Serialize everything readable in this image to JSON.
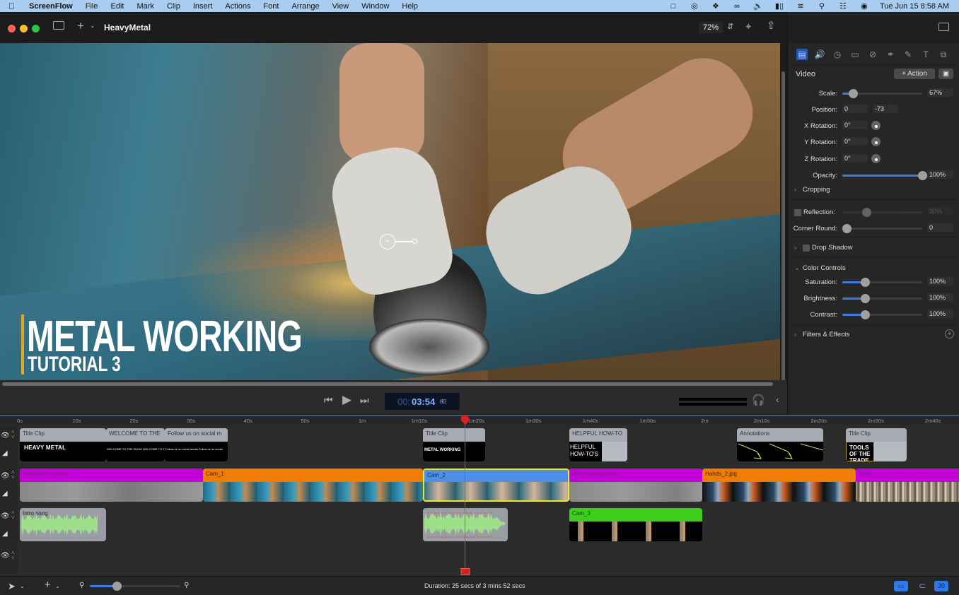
{
  "menubar": {
    "apple": "",
    "app_name": "ScreenFlow",
    "items": [
      "File",
      "Edit",
      "Mark",
      "Clip",
      "Insert",
      "Actions",
      "Font",
      "Arrange",
      "View",
      "Window",
      "Help"
    ],
    "status_icons": [
      "camera-icon",
      "creative-cloud-icon",
      "dropbox-icon",
      "adobe-icon",
      "volume-icon",
      "battery-icon",
      "wifi-icon",
      "search-icon",
      "control-center-icon",
      "siri-icon"
    ],
    "datetime": "Tue Jun 15  8:58 AM"
  },
  "window": {
    "title": "HeavyMetal",
    "add_label": "+",
    "zoom": "72%"
  },
  "preview": {
    "overlay_title": "METAL WORKING",
    "overlay_subtitle": "TUTORIAL 3",
    "overlay_accent": "#e4a51f"
  },
  "transport": {
    "timecode_hours": "00:",
    "timecode_main": "03:54",
    "timecode_frames": "80"
  },
  "inspector": {
    "tabs": [
      "video-icon",
      "audio-icon",
      "video-motion-icon",
      "screen-recording-icon",
      "callout-icon",
      "transition-icon",
      "annotation-icon",
      "text-icon",
      "media-library-icon"
    ],
    "section_title": "Video",
    "action_button": "+ Action",
    "scale_label": "Scale:",
    "scale_value": "67%",
    "scale_fraction": 0.13,
    "position_label": "Position:",
    "position_x": "0",
    "position_y": "-73",
    "x_rotation_label": "X Rotation:",
    "x_rotation": "0°",
    "y_rotation_label": "Y Rotation:",
    "y_rotation": "0°",
    "z_rotation_label": "Z Rotation:",
    "z_rotation": "0°",
    "opacity_label": "Opacity:",
    "opacity_value": "100%",
    "opacity_fraction": 1.0,
    "cropping_label": "Cropping",
    "reflection_label": "Reflection:",
    "reflection_value": "30%",
    "reflection_fraction": 0.3,
    "corner_round_label": "Corner Round:",
    "corner_round_value": "0",
    "drop_shadow_label": "Drop Shadow",
    "color_controls_label": "Color Controls",
    "saturation_label": "Saturation:",
    "saturation_value": "100%",
    "brightness_label": "Brightness:",
    "brightness_value": "100%",
    "contrast_label": "Contrast:",
    "contrast_value": "100%",
    "color_fraction": 0.28,
    "filters_label": "Filters & Effects"
  },
  "timeline": {
    "ruler": [
      "0s",
      "10s",
      "20s",
      "30s",
      "40s",
      "50s",
      "1m",
      "1m10s",
      "1m20s",
      "1m30s",
      "1m40s",
      "1m50s",
      "2m",
      "2m10s",
      "2m20s",
      "2m30s",
      "2m40s"
    ],
    "track1": [
      {
        "name": "Title Clip",
        "content": "HEAVY METAL"
      },
      {
        "name": "WELCOME TO THE",
        "content": "WELCOME TO THE SHOW WELCOME TO THE"
      },
      {
        "name": "Follow us on social m",
        "content": "Follow us on social media Follow us on social"
      },
      {
        "name": "Title Clip",
        "content": "METAL WORKING"
      },
      {
        "name": "HELPFUL  HOW-TO",
        "content": "HELPFUL HOW-TO'S"
      },
      {
        "name": "Annotations",
        "content": ""
      },
      {
        "name": "Title Clip",
        "content": "TOOLS OF THE TRADE"
      }
    ],
    "track2": [
      {
        "name": "Metal-Background",
        "color": "#c400d8"
      },
      {
        "name": "Cam_1",
        "color": "#f07c00"
      },
      {
        "name": "Cam_2",
        "color": "#4f8fe8"
      },
      {
        "name": "Metal-Background",
        "color": "#c400d8"
      },
      {
        "name": "Hands_2.jpg",
        "color": "#f07c00"
      },
      {
        "name": "Tools",
        "color": "#c400d8"
      }
    ],
    "track3": [
      {
        "name": "Intro song"
      },
      {
        "name": ""
      },
      {
        "name": "Cam_3",
        "color": "#3ccf1a"
      }
    ]
  },
  "bottombar": {
    "duration": "Duration: 25 secs of 3 mins 52 secs",
    "zoom_fraction": 0.3,
    "fps_label": "30"
  }
}
